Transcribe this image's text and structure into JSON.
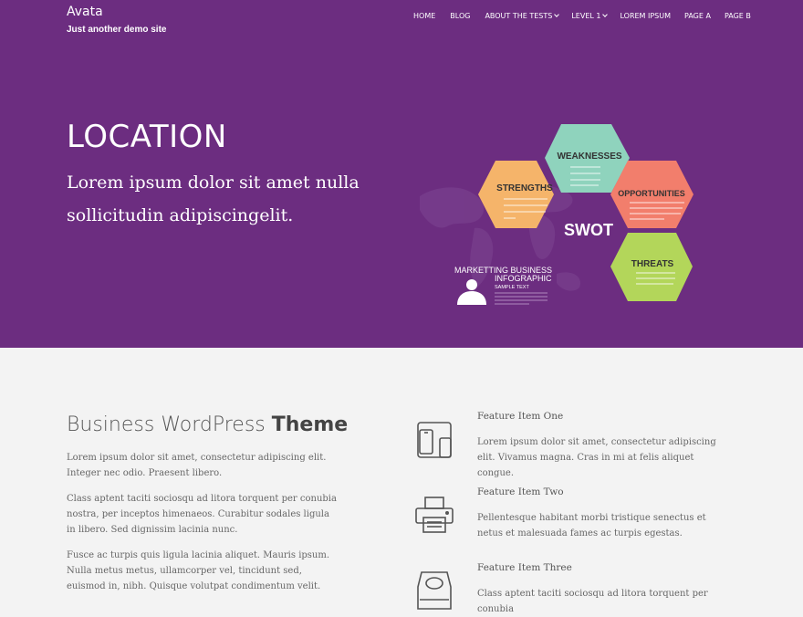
{
  "site": {
    "title": "Avata",
    "description": "Just another demo site"
  },
  "nav": {
    "items": [
      {
        "label": "HOME",
        "has_dropdown": false
      },
      {
        "label": "BLOG",
        "has_dropdown": false
      },
      {
        "label": "ABOUT THE TESTS",
        "has_dropdown": true
      },
      {
        "label": "LEVEL 1",
        "has_dropdown": true
      },
      {
        "label": "LOREM IPSUM",
        "has_dropdown": false
      },
      {
        "label": "PAGE A",
        "has_dropdown": false
      },
      {
        "label": "PAGE B",
        "has_dropdown": false
      }
    ]
  },
  "hero": {
    "heading": "LOCATION",
    "text": "Lorem ipsum dolor sit amet nulla sollicitudin adipiscingelit.",
    "background": "#6c2d80",
    "infographic": {
      "center_label": "SWOT",
      "caption_line1": "MARKETTING BUSINESS",
      "caption_line2": "INFOGRAPHIC",
      "caption_line3": "SAMPLE TEXT",
      "strengths": {
        "label": "STRENGTHS",
        "color": "#f5b46a"
      },
      "weaknesses": {
        "label": "WEAKNESSES",
        "color": "#8fd3bd"
      },
      "opportunities": {
        "label": "OPPORTUNITIES",
        "color": "#f27e6c"
      },
      "threats": {
        "label": "THREATS",
        "color": "#b3d65a"
      }
    }
  },
  "about": {
    "title_light": "Business WordPress",
    "title_bold": "Theme",
    "paragraphs": [
      "Lorem ipsum dolor sit amet, consectetur adipiscing elit. Integer nec odio. Praesent libero.",
      "Class aptent taciti sociosqu ad litora torquent per conubia nostra, per inceptos himenaeos. Curabitur sodales ligula in libero. Sed dignissim lacinia nunc.",
      "Fusce ac turpis quis ligula lacinia aliquet. Mauris ipsum. Nulla metus metus, ullamcorper vel, tincidunt sed, euismod in, nibh. Quisque volutpat condimentum velit."
    ]
  },
  "features": [
    {
      "title": "Feature Item One",
      "text": "Lorem ipsum dolor sit amet, consectetur adipiscing elit. Vivamus magna. Cras in mi at felis aliquet congue.",
      "icon": "devices-icon"
    },
    {
      "title": "Feature Item Two",
      "text": "Pellentesque habitant morbi tristique senectus et netus et malesuada fames ac turpis egestas.",
      "icon": "printer-icon"
    },
    {
      "title": "Feature Item Three",
      "text": "Class aptent taciti sociosqu ad litora torquent per conubia",
      "icon": "drive-icon"
    }
  ]
}
